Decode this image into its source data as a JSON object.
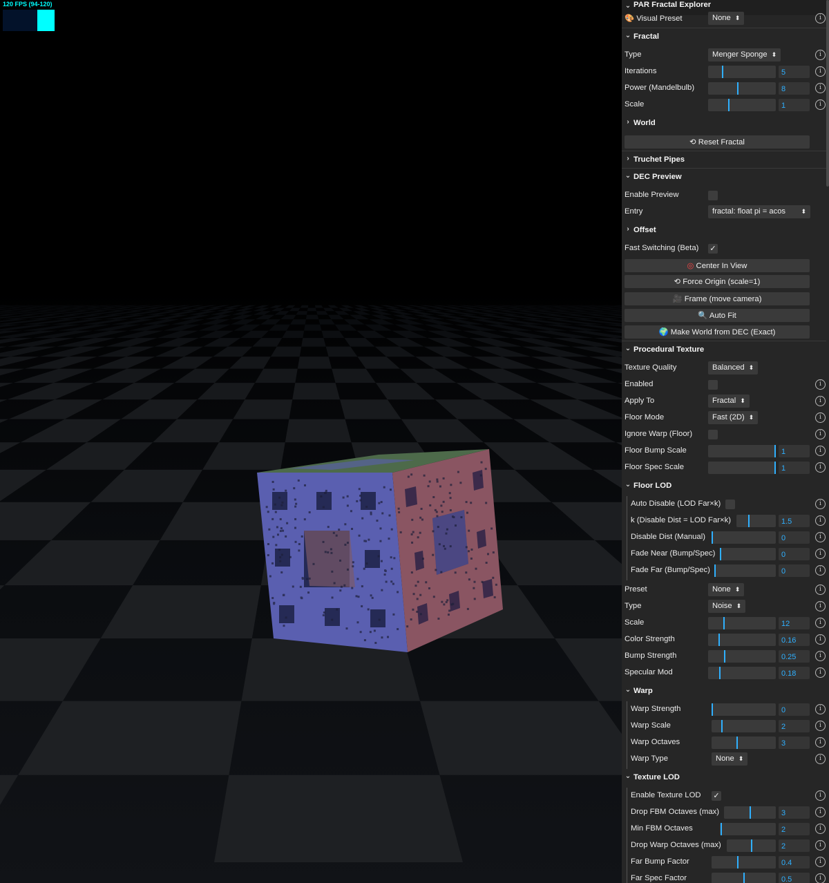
{
  "fps": {
    "label": "120 FPS (94-120)",
    "fill": 1.0
  },
  "panel": {
    "title": "PAR Fractal Explorer",
    "visual_preset": {
      "label": "Visual Preset",
      "value": "None"
    },
    "fractal": {
      "title": "Fractal",
      "type": {
        "label": "Type",
        "value": "Menger Sponge"
      },
      "iterations": {
        "label": "Iterations",
        "value": "5"
      },
      "power": {
        "label": "Power (Mandelbulb)",
        "value": "8"
      },
      "scale": {
        "label": "Scale",
        "value": "1"
      }
    },
    "world": {
      "title": "World"
    },
    "reset_fractal": "Reset Fractal",
    "truchet": {
      "title": "Truchet Pipes"
    },
    "dec_preview": {
      "title": "DEC Preview",
      "enable_preview": {
        "label": "Enable Preview"
      },
      "entry": {
        "label": "Entry",
        "value": "fractal: float pi = acos"
      },
      "offset": {
        "title": "Offset"
      },
      "fast_switching": {
        "label": "Fast Switching (Beta)"
      },
      "center_in_view": "Center In View",
      "force_origin": "Force Origin (scale=1)",
      "frame_camera": "Frame (move camera)",
      "auto_fit": "Auto Fit",
      "make_world": "Make World from DEC (Exact)"
    },
    "procedural_texture": {
      "title": "Procedural Texture",
      "texture_quality": {
        "label": "Texture Quality",
        "value": "Balanced"
      },
      "enabled": {
        "label": "Enabled"
      },
      "apply_to": {
        "label": "Apply To",
        "value": "Fractal"
      },
      "floor_mode": {
        "label": "Floor Mode",
        "value": "Fast (2D)"
      },
      "ignore_warp": {
        "label": "Ignore Warp (Floor)"
      },
      "floor_bump": {
        "label": "Floor Bump Scale",
        "value": "1"
      },
      "floor_spec": {
        "label": "Floor Spec Scale",
        "value": "1"
      }
    },
    "floor_lod": {
      "title": "Floor LOD",
      "auto_disable": {
        "label": "Auto Disable (LOD Far×k)"
      },
      "k": {
        "label": "k (Disable Dist = LOD Far×k)",
        "value": "1.5"
      },
      "disable_dist": {
        "label": "Disable Dist (Manual)",
        "value": "0"
      },
      "fade_near": {
        "label": "Fade Near (Bump/Spec)",
        "value": "0"
      },
      "fade_far": {
        "label": "Fade Far (Bump/Spec)",
        "value": "0"
      }
    },
    "texture": {
      "preset": {
        "label": "Preset",
        "value": "None"
      },
      "type": {
        "label": "Type",
        "value": "Noise"
      },
      "scale": {
        "label": "Scale",
        "value": "12"
      },
      "color_strength": {
        "label": "Color Strength",
        "value": "0.16"
      },
      "bump_strength": {
        "label": "Bump Strength",
        "value": "0.25"
      },
      "specular_mod": {
        "label": "Specular Mod",
        "value": "0.18"
      }
    },
    "warp": {
      "title": "Warp",
      "strength": {
        "label": "Warp Strength",
        "value": "0"
      },
      "scale": {
        "label": "Warp Scale",
        "value": "2"
      },
      "octaves": {
        "label": "Warp Octaves",
        "value": "3"
      },
      "type": {
        "label": "Warp Type",
        "value": "None"
      }
    },
    "texture_lod": {
      "title": "Texture LOD",
      "enable": {
        "label": "Enable Texture LOD"
      },
      "drop_fbm": {
        "label": "Drop FBM Octaves (max)",
        "value": "3"
      },
      "min_fbm": {
        "label": "Min FBM Octaves",
        "value": "2"
      },
      "drop_warp": {
        "label": "Drop Warp Octaves (max)",
        "value": "2"
      },
      "far_bump": {
        "label": "Far Bump Factor",
        "value": "0.4"
      },
      "far_spec": {
        "label": "Far Spec Factor",
        "value": "0.5"
      }
    }
  },
  "colors": {
    "accent": "#2fb0ff",
    "fps": "#00ffff",
    "panel_bg": "#262626"
  },
  "icons": {
    "chevron_down": "⌄",
    "chevron_right": "›",
    "info": "i",
    "select_arrows": "⬍",
    "check": "✓"
  }
}
